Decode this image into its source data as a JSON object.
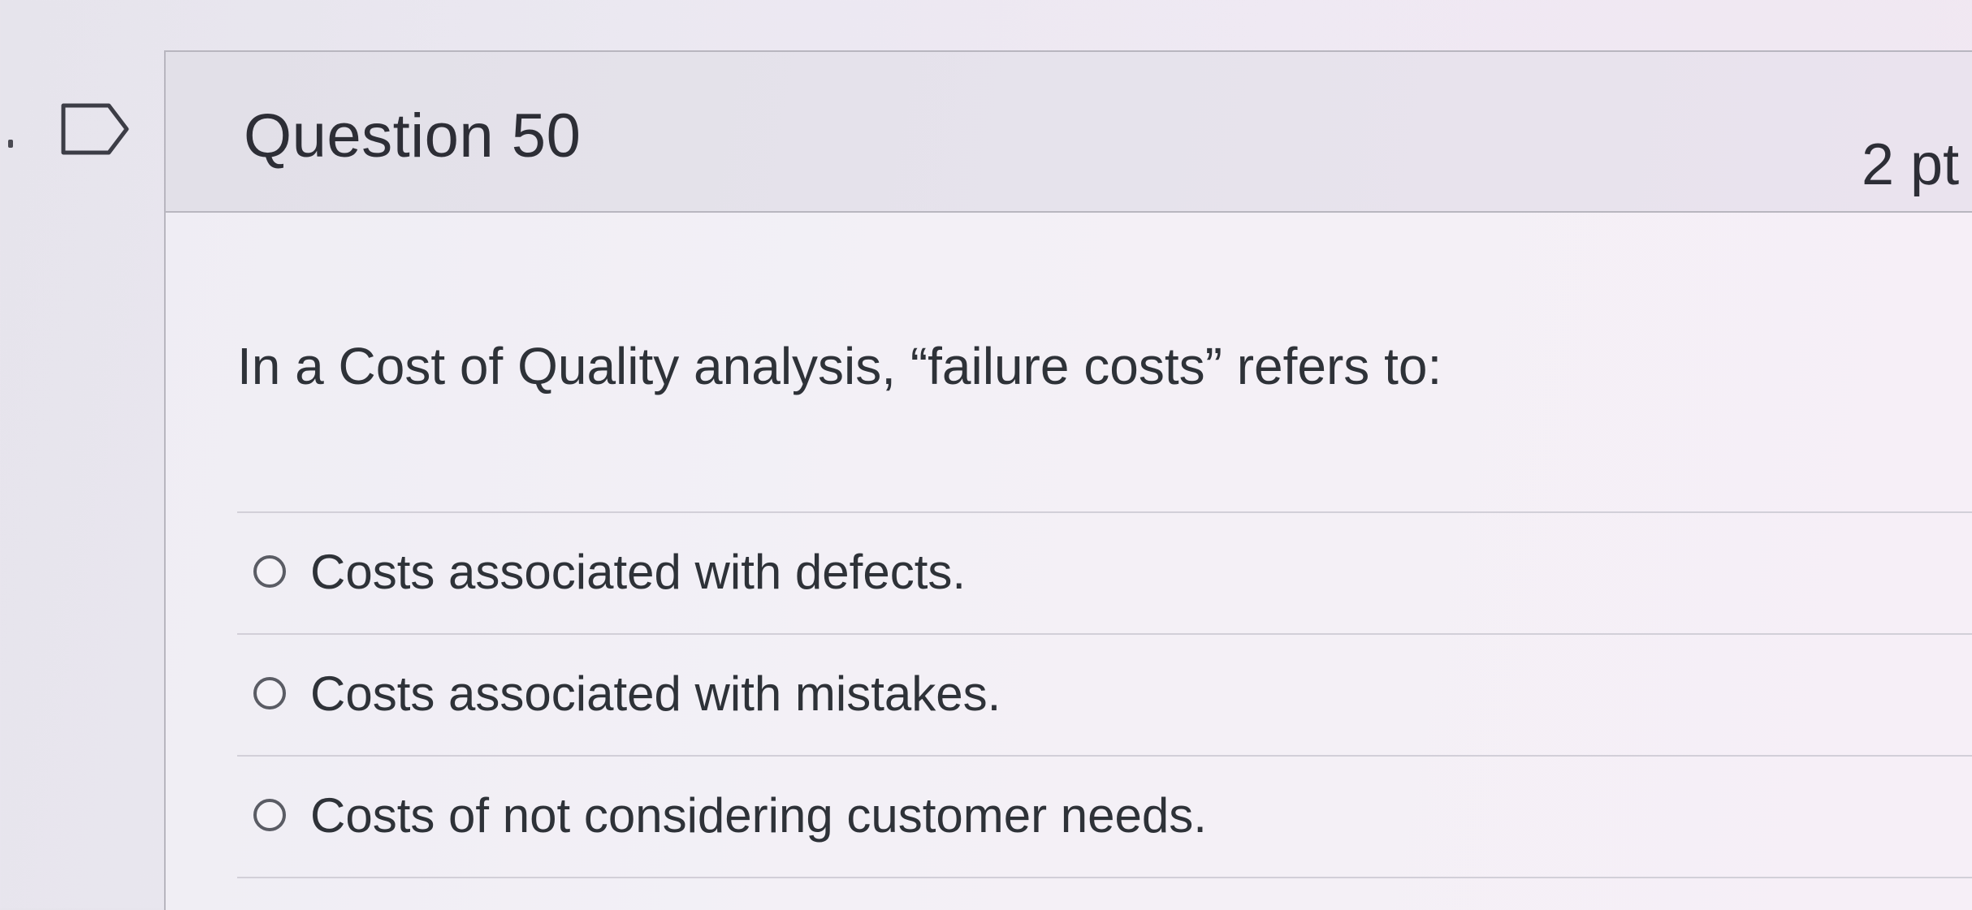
{
  "question": {
    "title": "Question 50",
    "points": "2 pt"
  },
  "prompt": "In a Cost of Quality analysis, “failure costs” refers to:",
  "answers": [
    {
      "label": "Costs associated with defects."
    },
    {
      "label": "Costs associated with mistakes."
    },
    {
      "label": "Costs of not considering customer needs."
    }
  ],
  "icons": {
    "flag": "flag-icon",
    "radio": "radio-button"
  }
}
